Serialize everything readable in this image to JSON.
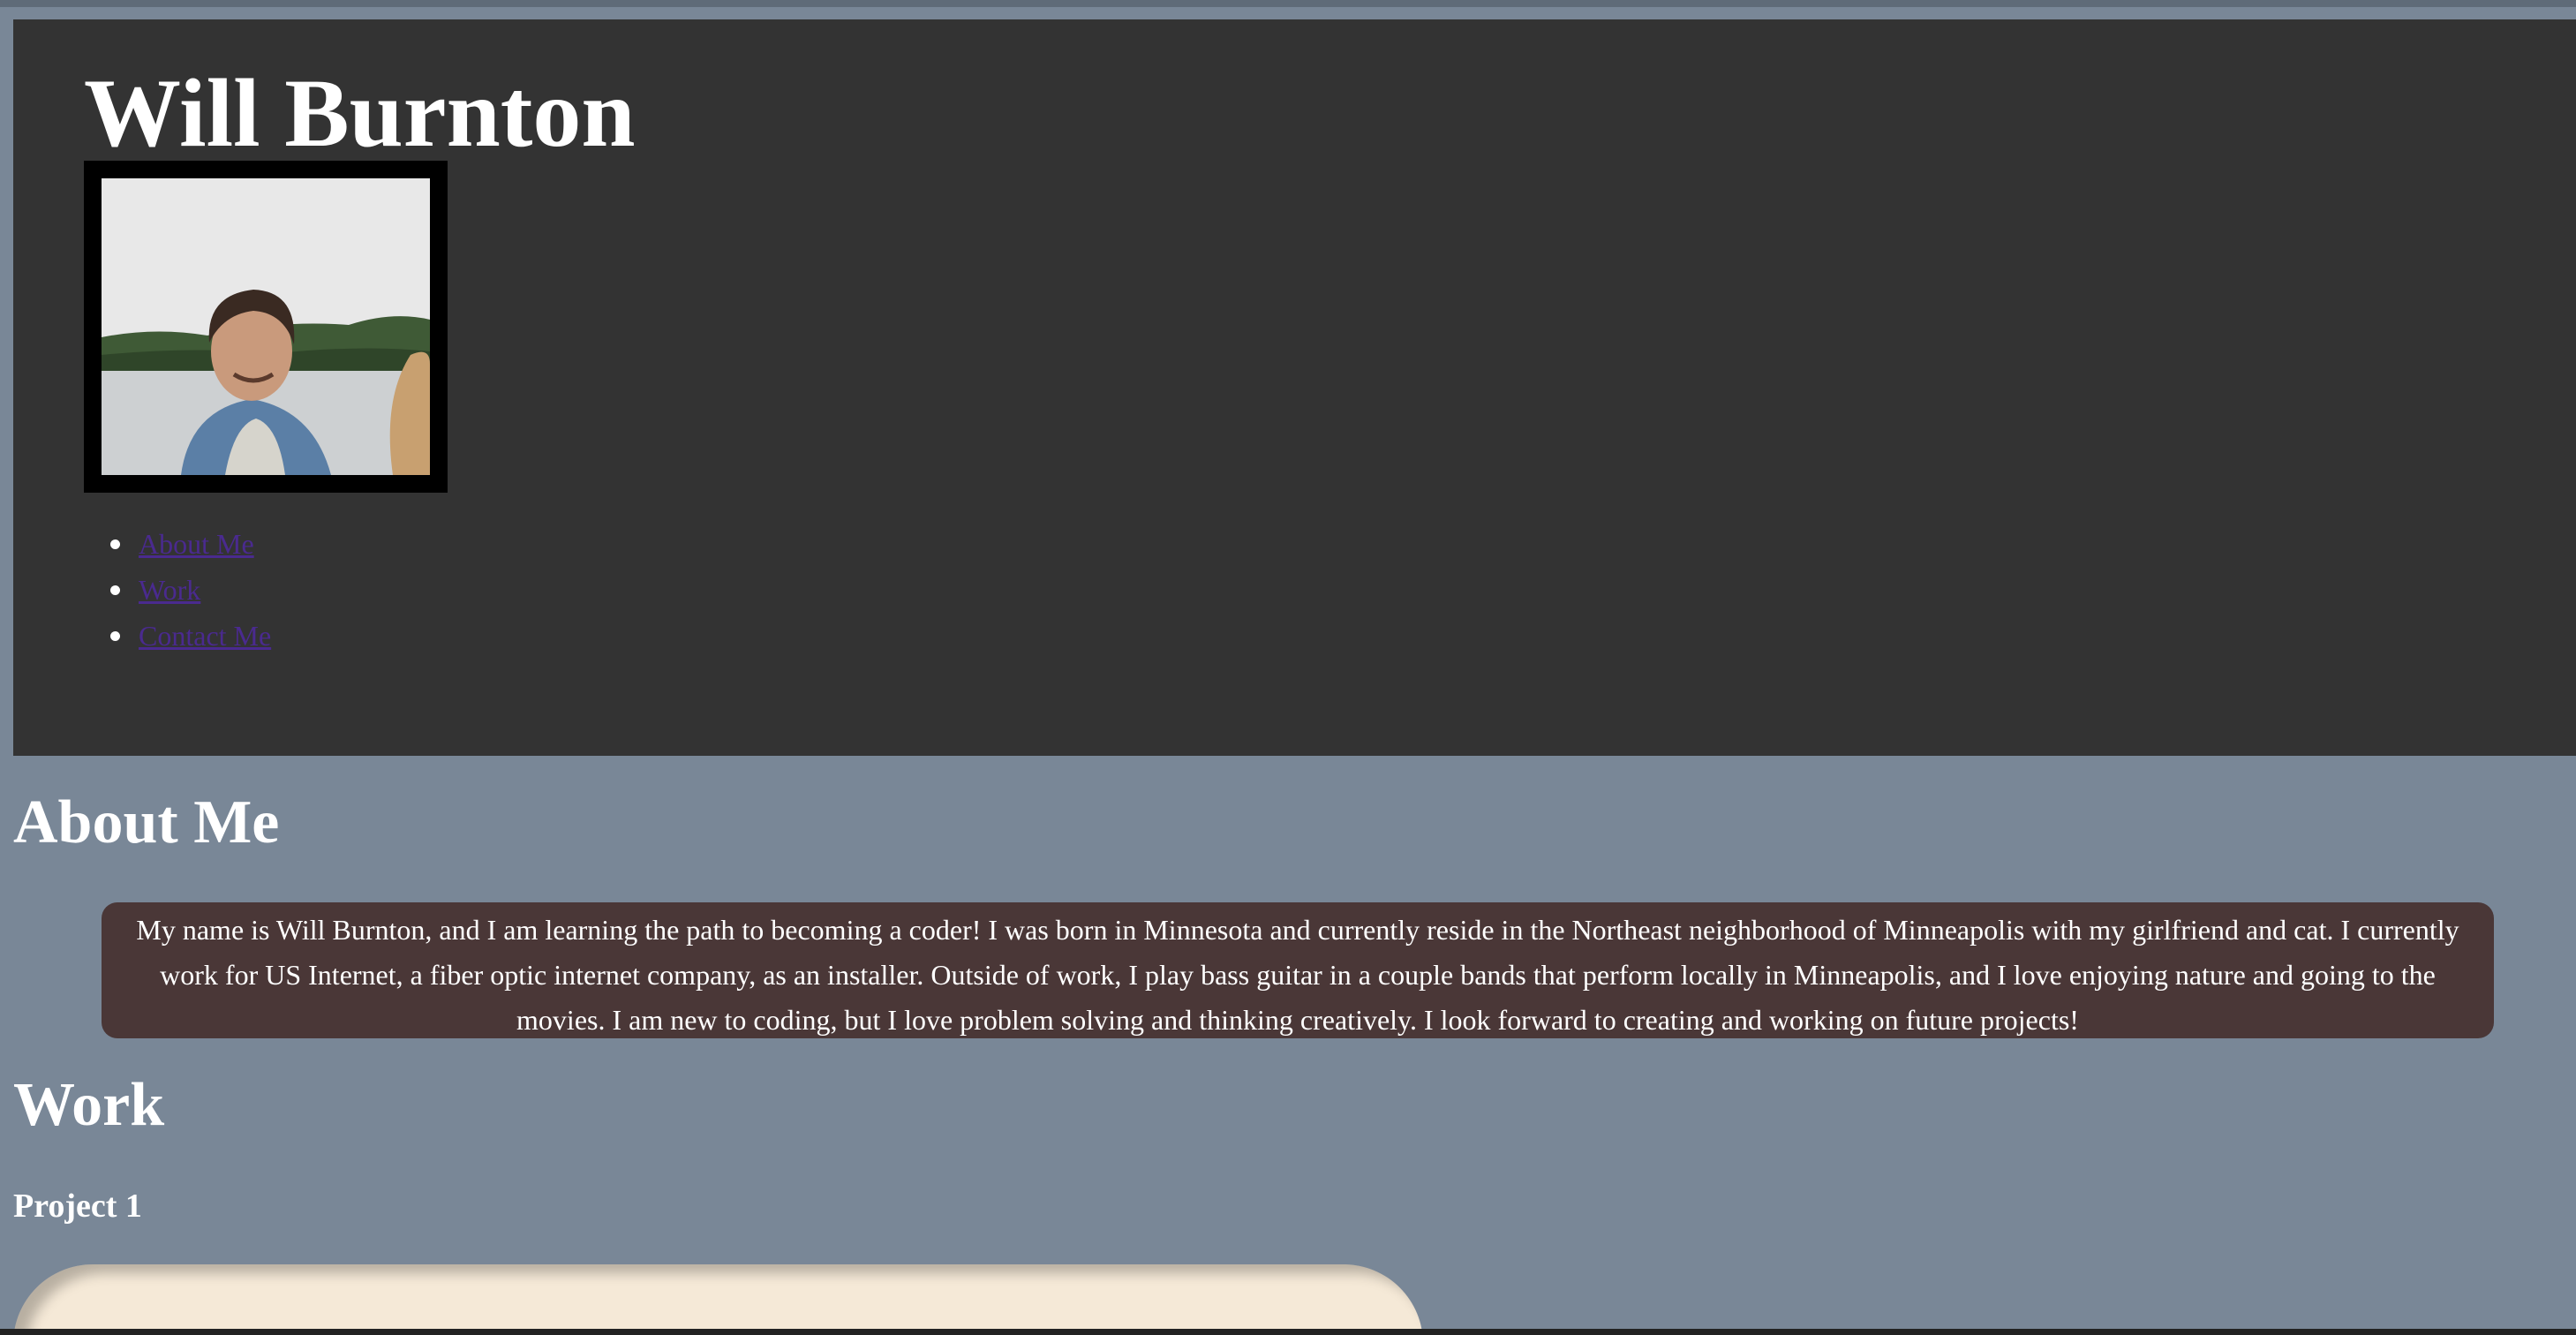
{
  "header": {
    "title": "Will Burnton",
    "portrait_alt": "Will Burnton"
  },
  "nav": {
    "items": [
      {
        "label": "About Me"
      },
      {
        "label": "Work"
      },
      {
        "label": "Contact Me"
      }
    ]
  },
  "about": {
    "heading": "About Me",
    "body": "My name is Will Burnton, and I am learning the path to becoming a coder! I was born in Minnesota and currently reside in the Northeast neighborhood of Minneapolis with my girlfriend and cat. I currently work for US Internet, a fiber optic internet company, as an installer. Outside of work, I play bass guitar in a couple bands that perform locally in Minneapolis, and I love enjoying nature and going to the movies. I am new to coding, but I love problem solving and thinking creatively. I look forward to creating and working on future projects!"
  },
  "work": {
    "heading": "Work",
    "projects": [
      {
        "title": "Project 1"
      }
    ]
  },
  "colors": {
    "page_background": "#798797",
    "header_background": "#333333",
    "about_box_background": "#4a3737",
    "link_color": "#4a2a8f",
    "project_card": "#f5e9d7"
  }
}
